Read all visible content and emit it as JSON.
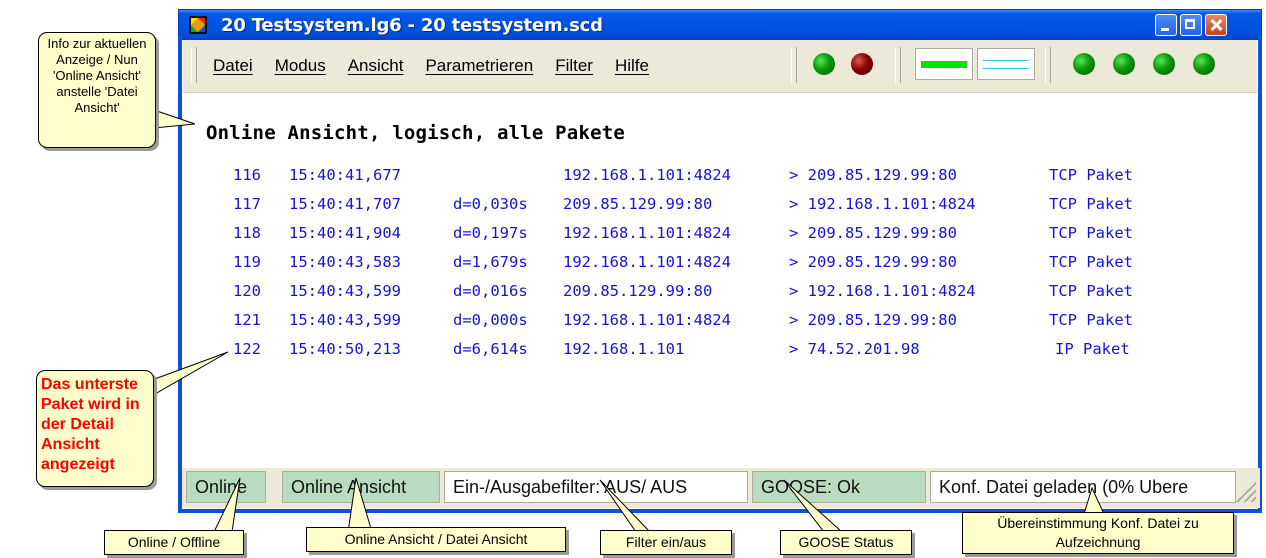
{
  "window": {
    "title": "20 Testsystem.lg6 - 20 testsystem.scd",
    "title_buttons": [
      "minimize-icon",
      "maximize-icon",
      "close-icon"
    ]
  },
  "menu": {
    "items": [
      "Datei",
      "Modus",
      "Ansicht",
      "Parametrieren",
      "Filter",
      "Hilfe"
    ]
  },
  "toolbar": {
    "status_leds": [
      "green",
      "darkred"
    ],
    "indicators": [
      "green-bar",
      "cyan-lines"
    ],
    "goose_leds": [
      "green",
      "green",
      "green",
      "green"
    ]
  },
  "view": {
    "title": "Online Ansicht, logisch, alle Pakete"
  },
  "packets": [
    {
      "no": "116",
      "time": "15:40:41,677",
      "delta": "",
      "src": "192.168.1.101:4824",
      "dst": "> 209.85.129.99:80",
      "type": "TCP Paket"
    },
    {
      "no": "117",
      "time": "15:40:41,707",
      "delta": "d=0,030s",
      "src": "209.85.129.99:80",
      "dst": "> 192.168.1.101:4824",
      "type": "TCP Paket"
    },
    {
      "no": "118",
      "time": "15:40:41,904",
      "delta": "d=0,197s",
      "src": "192.168.1.101:4824",
      "dst": "> 209.85.129.99:80",
      "type": "TCP Paket"
    },
    {
      "no": "119",
      "time": "15:40:43,583",
      "delta": "d=1,679s",
      "src": "192.168.1.101:4824",
      "dst": "> 209.85.129.99:80",
      "type": "TCP Paket"
    },
    {
      "no": "120",
      "time": "15:40:43,599",
      "delta": "d=0,016s",
      "src": "209.85.129.99:80",
      "dst": "> 192.168.1.101:4824",
      "type": "TCP Paket"
    },
    {
      "no": "121",
      "time": "15:40:43,599",
      "delta": "d=0,000s",
      "src": "192.168.1.101:4824",
      "dst": "> 209.85.129.99:80",
      "type": "TCP Paket"
    },
    {
      "no": "122",
      "time": "15:40:50,213",
      "delta": "d=6,614s",
      "src": "192.168.1.101",
      "dst": "> 74.52.201.98",
      "type": "IP Paket"
    }
  ],
  "statusbar": {
    "connection": "Online",
    "view_mode": "Online Ansicht",
    "filter": "Ein-/Ausgabefilter: AUS/ AUS",
    "goose": "GOOSE: Ok",
    "config": "Konf. Datei geladen (0% Ubere"
  },
  "callouts": {
    "info": "Info zur aktuellen Anzeige / Nun 'Online Ansicht' anstelle 'Datei Ansicht'",
    "detail": "Das unterste Paket wird in der Detail Ansicht angezeigt",
    "online_offline": "Online / Offline",
    "view_mode": "Online Ansicht / Datei Ansicht",
    "filter": "Filter ein/aus",
    "goose": "GOOSE Status",
    "config": "Übereinstimmung Konf. Datei zu Aufzeichnung"
  },
  "colors": {
    "titlebar": "#0054e3",
    "packet_text": "#1414d8",
    "statusbar_green": "#b9dcc1",
    "callout_bg": "#ffffcc",
    "callout_red_text": "#ff0000"
  }
}
